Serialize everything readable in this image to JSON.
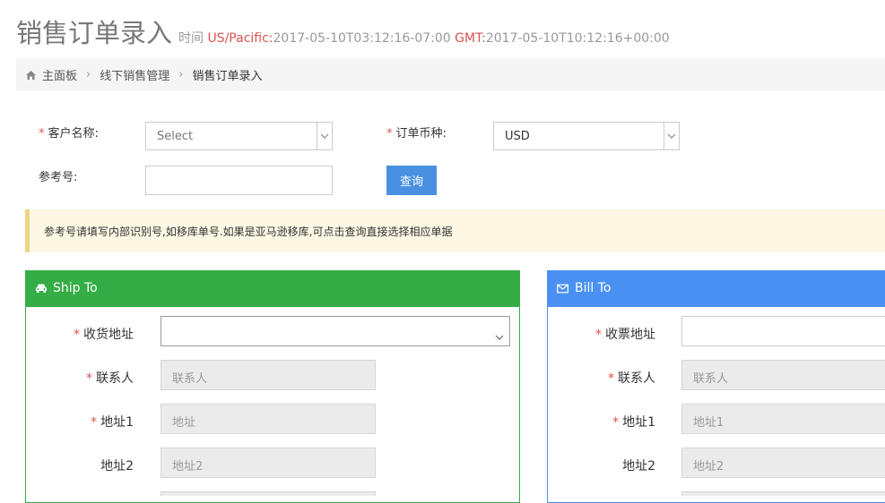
{
  "header": {
    "title": "销售订单录入",
    "time_label": "时间",
    "tz1_label": "US/Pacific:",
    "tz1_value": "2017-05-10T03:12:16-07:00",
    "tz2_label": "GMT:",
    "tz2_value": "2017-05-10T10:12:16+00:00"
  },
  "breadcrumb": {
    "home": "主面板",
    "section": "线下销售管理",
    "current": "销售订单录入"
  },
  "form": {
    "customer_label": "客户名称:",
    "customer_value": "Select",
    "currency_label": "订单币种:",
    "currency_value": "USD",
    "reference_label": "参考号:",
    "reference_value": "",
    "query_button": "查询"
  },
  "notice": {
    "text": "参考号请填写内部识别号,如移库单号.如果是亚马逊移库,可点击查询直接选择相应单据"
  },
  "ship_to": {
    "title": "Ship To",
    "address_label": "收货地址",
    "contact_label": "联系人",
    "contact_placeholder": "联系人",
    "address1_label": "地址1",
    "address1_placeholder": "地址",
    "address2_label": "地址2",
    "address2_placeholder": "地址2"
  },
  "bill_to": {
    "title": "Bill To",
    "address_label": "收票地址",
    "contact_label": "联系人",
    "contact_placeholder": "联系人",
    "address1_label": "地址1",
    "address1_placeholder": "地址1",
    "address2_label": "地址2",
    "address2_placeholder": "地址2"
  },
  "colors": {
    "ship_header": "#34ad46",
    "bill_header": "#4a90f2",
    "required": "#d9534f",
    "primary_button": "#4a90e2",
    "notice_bg": "#fcf8e3"
  },
  "icons": {
    "home": "home-icon",
    "ship": "car-icon",
    "bill": "envelope-icon"
  }
}
